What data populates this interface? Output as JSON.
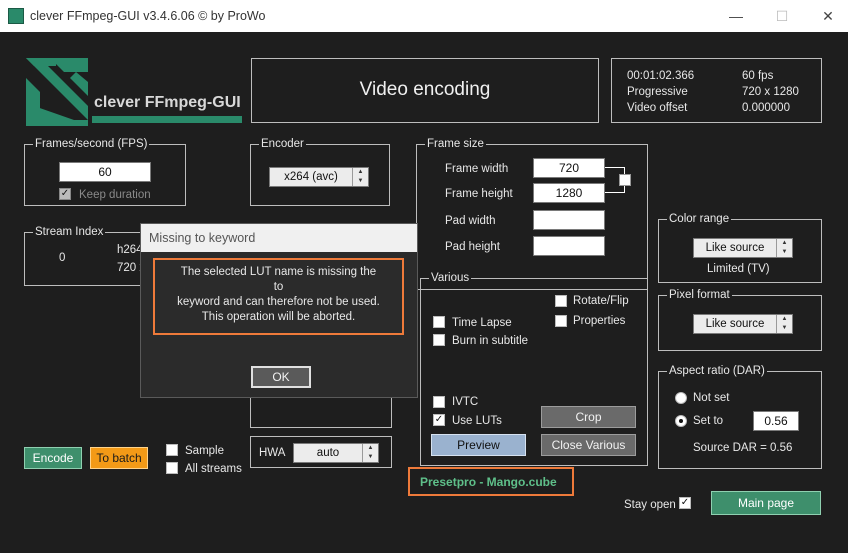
{
  "window": {
    "title": "clever FFmpeg-GUI v3.4.6.06   © by ProWo",
    "minimize": "—",
    "maximize": "☐",
    "close": "✕"
  },
  "logo": {
    "text": "clever FFmpeg-GUI"
  },
  "header": {
    "title": "Video encoding"
  },
  "info": {
    "rows": [
      {
        "label": "00:01:02.366",
        "value": "60 fps"
      },
      {
        "label": "Progressive",
        "value": "720 x 1280"
      },
      {
        "label": "Video offset",
        "value": "0.000000"
      }
    ]
  },
  "fps": {
    "label": "Frames/second (FPS)",
    "value": "60",
    "keep_label": "Keep duration",
    "keep_checked": "✓"
  },
  "encoder": {
    "label": "Encoder",
    "value": "x264 (avc)"
  },
  "frame_size": {
    "label": "Frame size",
    "width_label": "Frame width",
    "width_value": "720",
    "height_label": "Frame height",
    "height_value": "1280",
    "padw_label": "Pad width",
    "padw_value": "",
    "padh_label": "Pad height",
    "padh_value": ""
  },
  "stream_index": {
    "label": "Stream Index",
    "index": "0",
    "codec": "h264",
    "size": "720 x"
  },
  "color_range": {
    "label": "Color range",
    "value": "Like source",
    "note": "Limited (TV)"
  },
  "pixel_format": {
    "label": "Pixel format",
    "value": "Like source"
  },
  "aspect": {
    "label": "Aspect ratio (DAR)",
    "not_set": "Not set",
    "set_to": "Set to",
    "set_value": "0.56",
    "source": "Source DAR = 0.56"
  },
  "various": {
    "label": "Various",
    "time_lapse": "Time Lapse",
    "burn_subtitle": "Burn in subtitle",
    "rotate_flip": "Rotate/Flip",
    "properties": "Properties",
    "ivtc": "IVTC",
    "use_luts": "Use LUTs",
    "use_luts_check": "✓",
    "crop": "Crop",
    "preview": "Preview",
    "close_various": "Close Various"
  },
  "preset": {
    "text": "Presetpro - Mango.cube"
  },
  "bottom": {
    "encode": "Encode",
    "to_batch": "To batch",
    "sample": "Sample",
    "all_streams": "All streams",
    "hwa_label": "HWA",
    "hwa_value": "auto",
    "stay_open": "Stay open",
    "stay_open_check": "✓",
    "main_page": "Main page"
  },
  "dialog": {
    "title": "Missing to keyword",
    "message_lines": [
      "The selected LUT name is missing the",
      "to",
      "keyword and can therefore not be used.",
      "This operation will be aborted."
    ],
    "ok": "OK"
  },
  "colors": {
    "accent_green": "#3e8f6c",
    "orange": "#f39a17",
    "highlight": "#ee7a3a",
    "logo": "#2a8a6a"
  }
}
